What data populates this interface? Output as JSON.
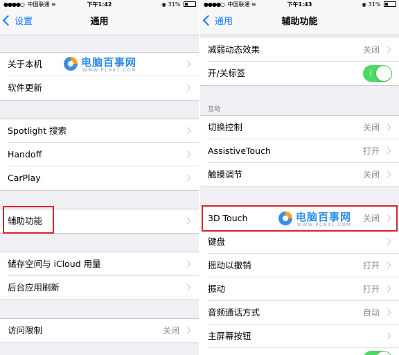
{
  "watermark": {
    "brand": "电脑百事网",
    "url": "WWW.PC841.COM"
  },
  "left": {
    "status": {
      "carrier": "中国联通",
      "time": "下午1:42",
      "battery": "31%"
    },
    "nav": {
      "back": "设置",
      "title": "通用"
    },
    "rows": {
      "about": "关于本机",
      "software_update": "软件更新",
      "spotlight": "Spotlight 搜索",
      "handoff": "Handoff",
      "carplay": "CarPlay",
      "accessibility": "辅助功能",
      "storage": "储存空间与 iCloud 用量",
      "background_refresh": "后台应用刷新",
      "restrictions": "访问限制",
      "restrictions_value": "关闭"
    }
  },
  "right": {
    "status": {
      "carrier": "中国联通",
      "time": "下午1:43",
      "battery": "31%"
    },
    "nav": {
      "back": "通用",
      "title": "辅助功能"
    },
    "rows": {
      "reduce_motion": "减弱动态效果",
      "reduce_motion_value": "关闭",
      "on_off_labels": "开/关标签",
      "interaction_header": "互动",
      "switch_control": "切换控制",
      "switch_control_value": "关闭",
      "assistive_touch": "AssistiveTouch",
      "assistive_touch_value": "打开",
      "touch_accommodations": "触摸调节",
      "touch_accommodations_value": "关闭",
      "touch_3d": "3D Touch",
      "touch_3d_value": "关闭",
      "keyboard": "键盘",
      "shake_to_undo": "摇动以撤销",
      "shake_to_undo_value": "打开",
      "vibration": "振动",
      "vibration_value": "打开",
      "call_audio_routing": "音频通话方式",
      "call_audio_routing_value": "自动",
      "home_button": "主屏幕按钮"
    }
  },
  "colors": {
    "accent": "#0a7aff",
    "toggle_on": "#4cd964",
    "highlight": "#d9232d"
  }
}
